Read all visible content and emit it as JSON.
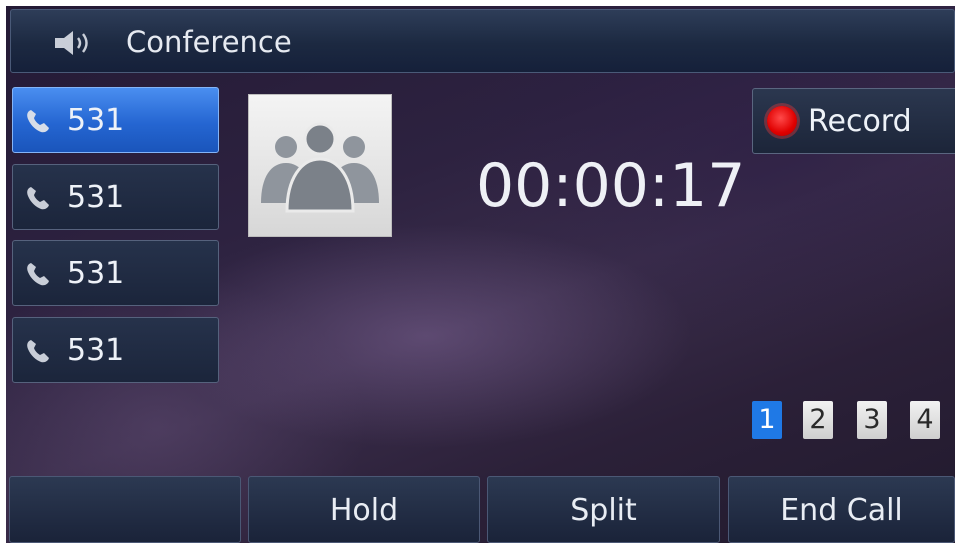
{
  "header": {
    "title": "Conference",
    "icon": "speaker-icon"
  },
  "lines": [
    {
      "label": "531",
      "active": true
    },
    {
      "label": "531",
      "active": false
    },
    {
      "label": "531",
      "active": false
    },
    {
      "label": "531",
      "active": false
    }
  ],
  "call": {
    "avatar_icon": "conference-group-icon",
    "duration": "00:00:17"
  },
  "record": {
    "label": "Record",
    "icon": "record-dot-icon",
    "icon_color": "#e00000"
  },
  "pages": {
    "items": [
      "1",
      "2",
      "3",
      "4"
    ],
    "selected": "1"
  },
  "softkeys": {
    "key1": "",
    "key2": "Hold",
    "key3": "Split",
    "key4": "End Call"
  },
  "colors": {
    "accent": "#2566d2",
    "page_selected": "#1f79e6"
  }
}
